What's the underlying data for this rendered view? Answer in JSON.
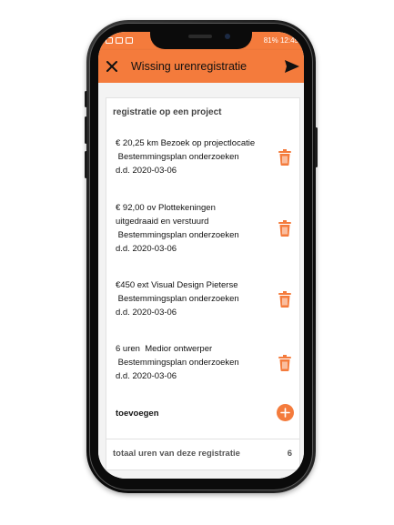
{
  "statusbar": {
    "right_text": "81% 12:45"
  },
  "appbar": {
    "title": "Wissing urenregistratie"
  },
  "section": {
    "title": "registratie op een project"
  },
  "items": [
    {
      "lines": [
        "€ 20,25 km Bezoek op projectlocatie",
        " Bestemmingsplan onderzoeken",
        "d.d. 2020-03-06"
      ]
    },
    {
      "lines": [
        "€ 92,00 ov Plottekeningen",
        "uitgedraaid en verstuurd",
        " Bestemmingsplan onderzoeken",
        "d.d. 2020-03-06"
      ]
    },
    {
      "lines": [
        "€450 ext Visual Design Pieterse",
        " Bestemmingsplan onderzoeken",
        "d.d. 2020-03-06"
      ]
    },
    {
      "lines": [
        "6 uren  Medior ontwerper",
        " Bestemmingsplan onderzoeken",
        "d.d. 2020-03-06"
      ]
    }
  ],
  "add": {
    "label": "toevoegen"
  },
  "total": {
    "label": "totaal uren van deze registratie",
    "value": "6"
  },
  "colors": {
    "accent": "#f47b3c"
  },
  "icons": {
    "close": "close-icon",
    "send": "send-icon",
    "trash": "trash-icon",
    "add": "plus-icon"
  }
}
